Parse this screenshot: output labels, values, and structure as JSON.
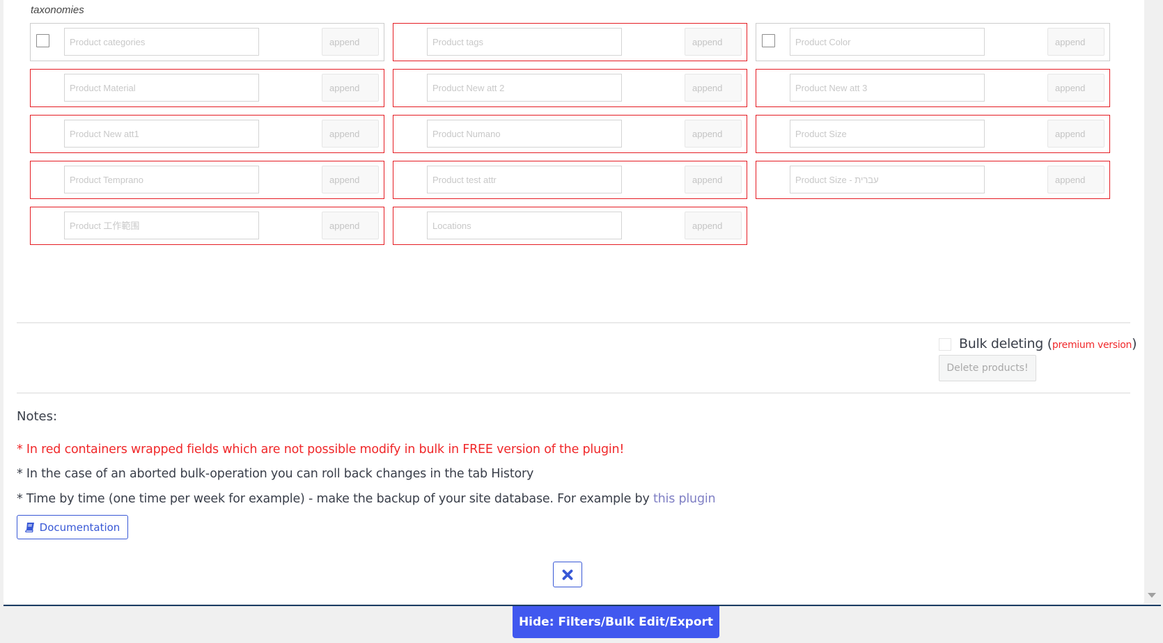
{
  "section_label": "taxonomies",
  "taxonomies": [
    {
      "placeholder": "Product categories",
      "append_placeholder": "append",
      "locked": false,
      "has_checkbox": true
    },
    {
      "placeholder": "Product tags",
      "append_placeholder": "append",
      "locked": true,
      "has_checkbox": false
    },
    {
      "placeholder": "Product Color",
      "append_placeholder": "append",
      "locked": false,
      "has_checkbox": true
    },
    {
      "placeholder": "Product Material",
      "append_placeholder": "append",
      "locked": true,
      "has_checkbox": false
    },
    {
      "placeholder": "Product New att 2",
      "append_placeholder": "append",
      "locked": true,
      "has_checkbox": false
    },
    {
      "placeholder": "Product New att 3",
      "append_placeholder": "append",
      "locked": true,
      "has_checkbox": false
    },
    {
      "placeholder": "Product New att1",
      "append_placeholder": "append",
      "locked": true,
      "has_checkbox": false
    },
    {
      "placeholder": "Product Numano",
      "append_placeholder": "append",
      "locked": true,
      "has_checkbox": false
    },
    {
      "placeholder": "Product Size",
      "append_placeholder": "append",
      "locked": true,
      "has_checkbox": false
    },
    {
      "placeholder": "Product Temprano",
      "append_placeholder": "append",
      "locked": true,
      "has_checkbox": false
    },
    {
      "placeholder": "Product test attr",
      "append_placeholder": "append",
      "locked": true,
      "has_checkbox": false
    },
    {
      "placeholder": "Product Size - עברית",
      "append_placeholder": "append",
      "locked": true,
      "has_checkbox": false
    },
    {
      "placeholder": "Product 工作範围",
      "append_placeholder": "append",
      "locked": true,
      "has_checkbox": false
    },
    {
      "placeholder": "Locations",
      "append_placeholder": "append",
      "locked": true,
      "has_checkbox": false
    }
  ],
  "bulk_delete": {
    "label": "Bulk deleting",
    "open_paren": " (",
    "premium_label": "premium version",
    "close_paren": ")",
    "button_label": "Delete products!"
  },
  "notes": {
    "title": "Notes:",
    "red_note": "* In red containers wrapped fields which are not possible modify in bulk in FREE version of the plugin!",
    "history_note": "* In the case of an aborted bulk-operation you can roll back changes in the tab History",
    "backup_note_prefix": "* Time by time (one time per week for example) - make the backup of your site database. For example by ",
    "backup_link": "this plugin"
  },
  "documentation_button": "Documentation",
  "hide_button": "Hide: Filters/Bulk Edit/Export",
  "colors": {
    "locked_border": "#e51c23",
    "accent": "#3858d6",
    "hide_button_bg": "#4158ef",
    "warning_text": "#f0282a",
    "link": "#7f7fc4",
    "bottom_line": "#1a3c63"
  }
}
